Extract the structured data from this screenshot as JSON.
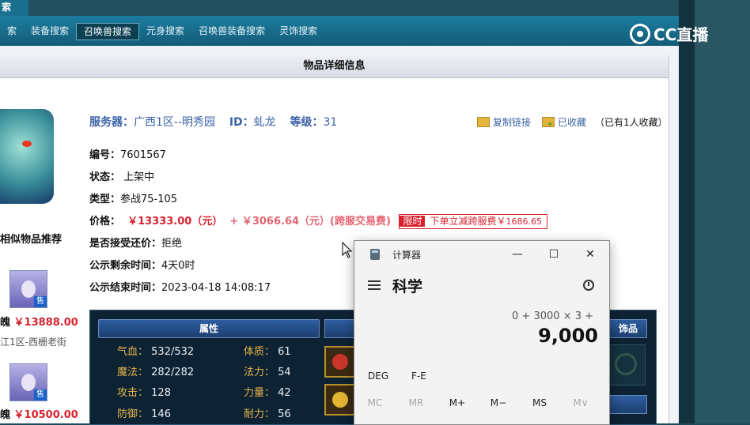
{
  "top_tab": "索",
  "nav": {
    "items": [
      {
        "label": "索",
        "active": false
      },
      {
        "label": "装备搜索",
        "active": false
      },
      {
        "label": "召唤兽搜索",
        "active": true
      },
      {
        "label": "元身搜索",
        "active": false
      },
      {
        "label": "召唤兽装备搜索",
        "active": false
      },
      {
        "label": "灵饰搜索",
        "active": false
      }
    ]
  },
  "logo": {
    "text": "CC直播"
  },
  "panel": {
    "title": "物品详细信息"
  },
  "recommend": {
    "header": "相似物品推荐",
    "items": [
      {
        "sold_badge": "售",
        "name_tail": "魄",
        "price": "￥13888.00",
        "server": "江1区-西栅老街"
      },
      {
        "sold_badge": "售",
        "name_tail": "魄",
        "price": "￥10500.00"
      }
    ]
  },
  "item": {
    "server_label": "服务器：",
    "server_value": "广西1区--明秀园",
    "id_label": "ID：",
    "id_value": "虬龙",
    "level_label": "等级：",
    "level_value": "31",
    "copy_link": "复制链接",
    "favorited": "已收藏",
    "fav_count_text": "（已有1人收藏）",
    "number_label": "编号：",
    "number_value": "7601567",
    "status_label": "状态：",
    "status_value": "上架中",
    "type_label": "类型：",
    "type_value": "参战75-105",
    "price_label": "价格：",
    "price_value": "￥13333.00（元）",
    "fee_value": "+ ￥3066.64（元）(跨服交易费)",
    "limited_tag": "限时",
    "discount_text": "下单立减跨服费￥",
    "discount_value": "1686.65",
    "bargain_label": "是否接受还价：",
    "bargain_value": "拒绝",
    "remain_label": "公示剩余时间：",
    "remain_value": "4天0时",
    "end_label": "公示结束时间：",
    "end_value": "2023-04-18 14:08:17"
  },
  "stats": {
    "header": "属性",
    "right_header": "饰品",
    "rows": [
      {
        "n1": "气血：",
        "v1": "532/532",
        "n2": "体质：",
        "v2": "61"
      },
      {
        "n1": "魔法：",
        "v1": "282/282",
        "n2": "法力：",
        "v2": "54"
      },
      {
        "n1": "攻击：",
        "v1": "128",
        "n2": "力量：",
        "v2": "42"
      },
      {
        "n1": "防御：",
        "v1": "146",
        "n2": "耐力：",
        "v2": "56"
      }
    ]
  },
  "calculator": {
    "title": "计算器",
    "minimize": "—",
    "maximize": "☐",
    "close": "✕",
    "mode": "科学",
    "expression": "0 + 3000 × 3 +",
    "result": "9,000",
    "angle": "DEG",
    "fe": "F-E",
    "memory": [
      {
        "label": "MC",
        "enabled": false
      },
      {
        "label": "MR",
        "enabled": false
      },
      {
        "label": "M+",
        "enabled": true
      },
      {
        "label": "M−",
        "enabled": true
      },
      {
        "label": "MS",
        "enabled": true
      },
      {
        "label": "M∨",
        "enabled": false
      }
    ]
  }
}
